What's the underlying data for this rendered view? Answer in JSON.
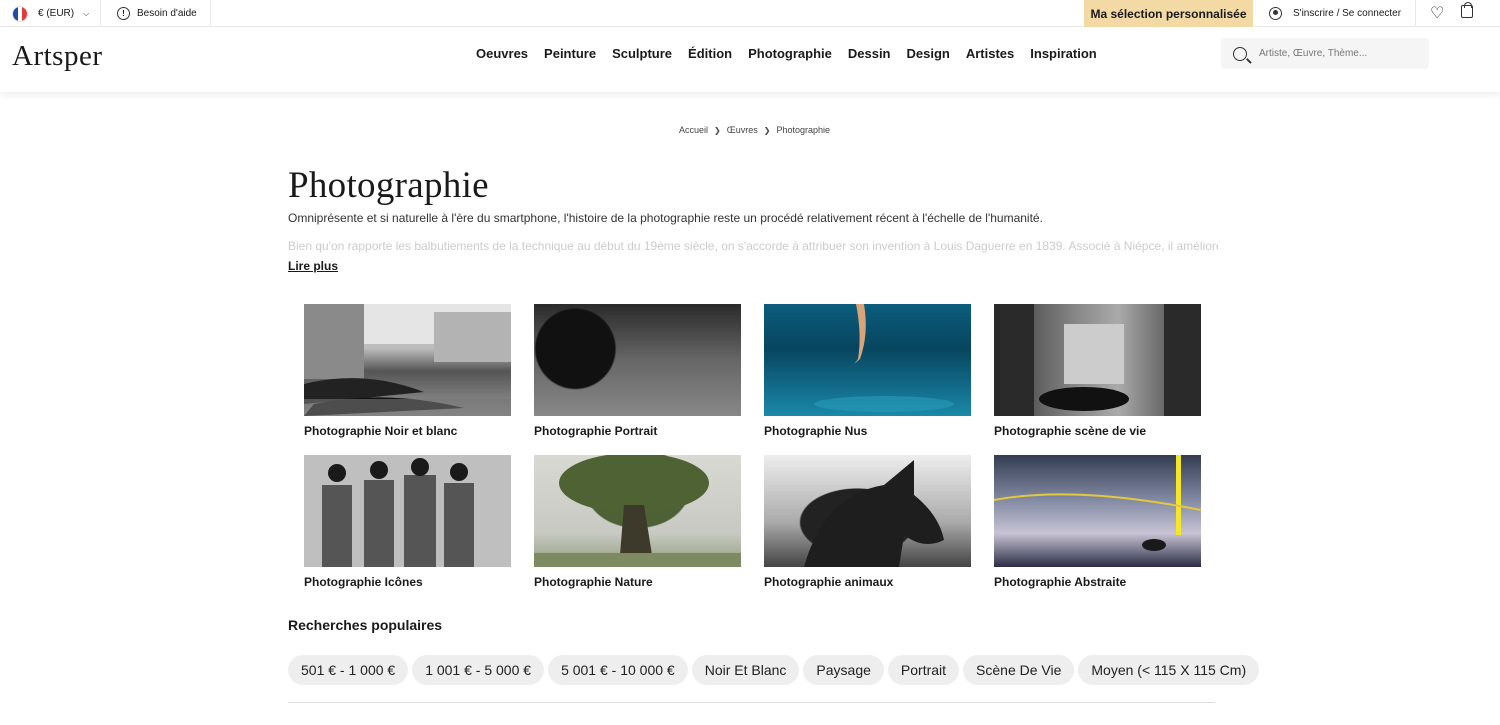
{
  "topbar": {
    "currency": "€ (EUR)",
    "help": "Besoin d'aide",
    "selection": "Ma sélection personnalisée",
    "login": "S'inscrire / Se connecter"
  },
  "header": {
    "logo": "Artsper",
    "nav": [
      "Oeuvres",
      "Peinture",
      "Sculpture",
      "Édition",
      "Photographie",
      "Dessin",
      "Design",
      "Artistes",
      "Inspiration"
    ],
    "search_placeholder": "Artiste, Œuvre, Thème..."
  },
  "breadcrumb": [
    "Accueil",
    "Œuvres",
    "Photographie"
  ],
  "page": {
    "title": "Photographie",
    "intro": "Omniprésente et si naturelle à l'ère du smartphone, l'histoire de la photographie reste un procédé relativement récent à l'échelle de l'humanité.",
    "intro_more": "Bien qu'on rapporte les balbutiements de la technique au début du 19ème siècle, on s'accorde à attribuer son invention à Louis Daguerre en 1839. Associé à Niépce, il améliore le temps",
    "read_more": "Lire plus"
  },
  "categories": [
    {
      "label": "Photographie Noir et blanc"
    },
    {
      "label": "Photographie Portrait"
    },
    {
      "label": "Photographie Nus"
    },
    {
      "label": "Photographie scène de vie"
    },
    {
      "label": "Photographie Icônes"
    },
    {
      "label": "Photographie Nature"
    },
    {
      "label": "Photographie animaux"
    },
    {
      "label": "Photographie Abstraite"
    }
  ],
  "popular": {
    "title": "Recherches populaires",
    "chips": [
      "501 € - 1 000 €",
      "1 001 € - 5 000 €",
      "5 001 € - 10 000 €",
      "Noir Et Blanc",
      "Paysage",
      "Portrait",
      "Scène De Vie",
      "Moyen (< 115 X 115 Cm)"
    ]
  },
  "colors": {
    "selection_bg": "#f3d9a4"
  }
}
